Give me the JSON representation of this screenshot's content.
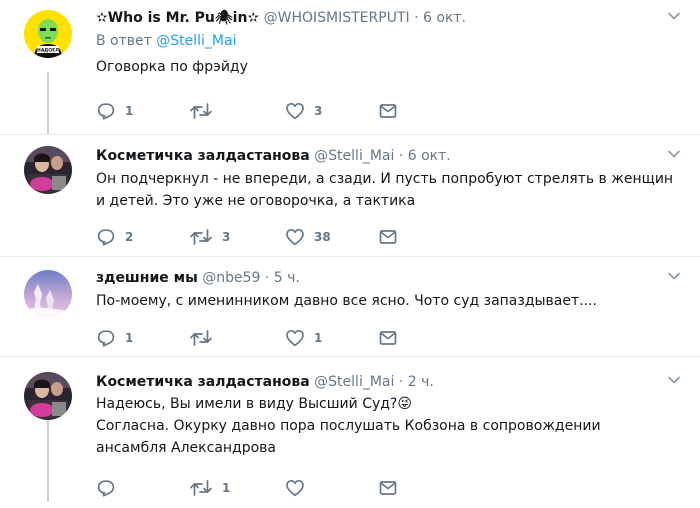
{
  "tweets": [
    {
      "name": "✫Who is Mr. Pu🕷in✫",
      "handle": "@WHOISMISTERPUTI",
      "dot": "·",
      "time": "6 окт.",
      "reply_prefix": "В ответ",
      "reply_handle": "@Stelli_Mai",
      "text_lines": [
        "Оговорка по фрэйду"
      ],
      "avatar_badge": "НАДОЕЛ",
      "replies": "1",
      "retweets": "",
      "likes": "3"
    },
    {
      "name": "Косметичка залдастанова",
      "handle": "@Stelli_Mai",
      "dot": "·",
      "time": "6 окт.",
      "text_lines": [
        "Он подчеркнул - не впереди, а сзади. И пусть попробуют стрелять в женщин",
        "и детей. Это уже не оговорочка, а тактика"
      ],
      "replies": "2",
      "retweets": "3",
      "likes": "38"
    },
    {
      "name": "здешние мы",
      "handle": "@nbe59",
      "dot": "·",
      "time": "5 ч.",
      "text_lines": [
        "По-моему, с именинником давно все ясно. Чото суд запаздывает...."
      ],
      "replies": "1",
      "retweets": "",
      "likes": "1"
    },
    {
      "name": "Косметичка залдастанова",
      "handle": "@Stelli_Mai",
      "dot": "·",
      "time": "2 ч.",
      "text_lines": [
        "Надеюсь, Вы имели в виду Высший Суд?😜",
        "Согласна. Окурку давно пора послушать Кобзона в сопровождении",
        "ансамбля Александрова"
      ],
      "replies": "",
      "retweets": "1",
      "likes": ""
    }
  ],
  "icons": {
    "reply": "reply-icon",
    "retweet": "retweet-icon",
    "like": "heart-icon",
    "dm": "envelope-icon",
    "menu": "chevron-down-icon"
  },
  "colors": {
    "text": "#14171a",
    "muted": "#657786",
    "link": "#1da1f2",
    "divider": "#e6ecf0",
    "thread_line": "#c4cfd6",
    "avatar1_bg": "#ffe100"
  }
}
